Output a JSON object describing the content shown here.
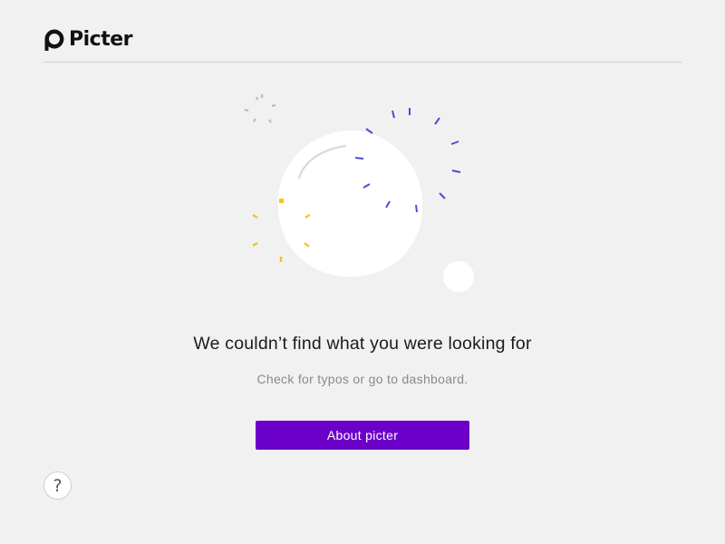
{
  "brand": {
    "name": "Picter",
    "logo_icon": "picter-logo-icon"
  },
  "main": {
    "title": "We couldn’t find what you were looking for",
    "subtitle": "Check for typos or go to dashboard.",
    "cta_label": "About picter"
  },
  "help": {
    "label": "?",
    "icon": "help-icon"
  },
  "illustration": {
    "name": "broken-lightbulb-illustration"
  },
  "colors": {
    "background": "#f1f1f1",
    "accent": "#6b00c8",
    "confetti_blue": "#4a4fd0",
    "confetti_yellow": "#f5c518",
    "confetti_gray": "#bdbdbd",
    "circle": "#ffffff"
  }
}
